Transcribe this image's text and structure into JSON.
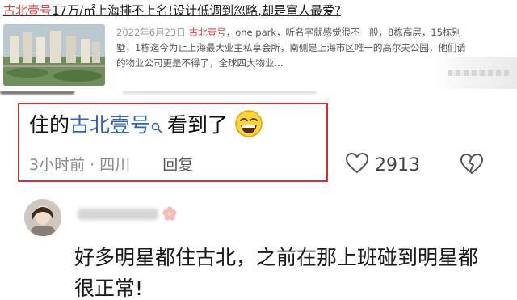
{
  "article": {
    "title_highlight": "古北壹号",
    "title_price": "17万/㎡",
    "title_rest": "上海排不上名!设计低调到忽略,却是富人最爱?",
    "date": "2022年6月23日",
    "keyword": "古北壹号",
    "snippet": "，one park，听名字就感觉很不一般，8栋高层，15栋别墅，1栋迄今为止上海最大业主私享会所，南侧是上海市区唯一的高尔夫公园，他们请的物业公司更是不得了，全球四大物业..."
  },
  "comment": {
    "prefix": "住的",
    "link": "古北壹号",
    "suffix": "看到了",
    "time": "3小时前 · 四川",
    "reply": "回复",
    "likes": "2913"
  },
  "reply_comment": {
    "text": "好多明星都住古北，之前在那上班碰到明星都很正常!"
  },
  "icons": [
    "search-icon",
    "laugh-emoji",
    "like-icon",
    "dislike-icon",
    "flower-icon",
    "avatar"
  ],
  "colors": {
    "link_blue": "#2f63b8",
    "keyword_red": "#e04343",
    "highlight_box": "#d32f2f"
  }
}
